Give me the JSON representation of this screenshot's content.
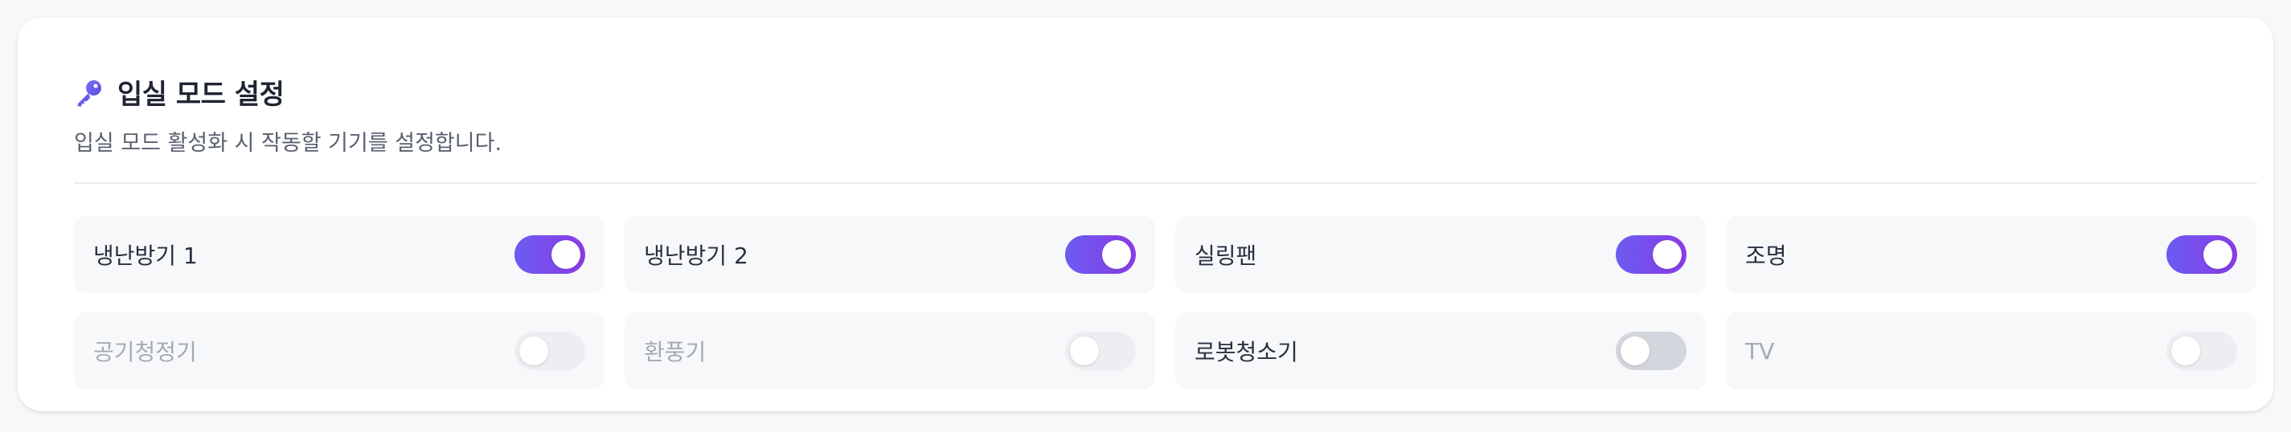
{
  "panel": {
    "title": "입실 모드 설정",
    "subtitle": "입실 모드 활성화 시 작동할 기기를 설정합니다.",
    "icon": "key-icon"
  },
  "colors": {
    "accent_start": "#6b5cf0",
    "accent_end": "#8a3be6",
    "toggle_off": "#d3d6dc",
    "toggle_disabled": "#eceef2"
  },
  "devices": [
    {
      "label": "냉난방기 1",
      "state": "on",
      "enabled": true
    },
    {
      "label": "냉난방기 2",
      "state": "on",
      "enabled": true
    },
    {
      "label": "실링팬",
      "state": "on",
      "enabled": true
    },
    {
      "label": "조명",
      "state": "on",
      "enabled": true
    },
    {
      "label": "공기청정기",
      "state": "off",
      "enabled": false
    },
    {
      "label": "환풍기",
      "state": "off",
      "enabled": false
    },
    {
      "label": "로봇청소기",
      "state": "off",
      "enabled": true
    },
    {
      "label": "TV",
      "state": "off",
      "enabled": false
    }
  ]
}
